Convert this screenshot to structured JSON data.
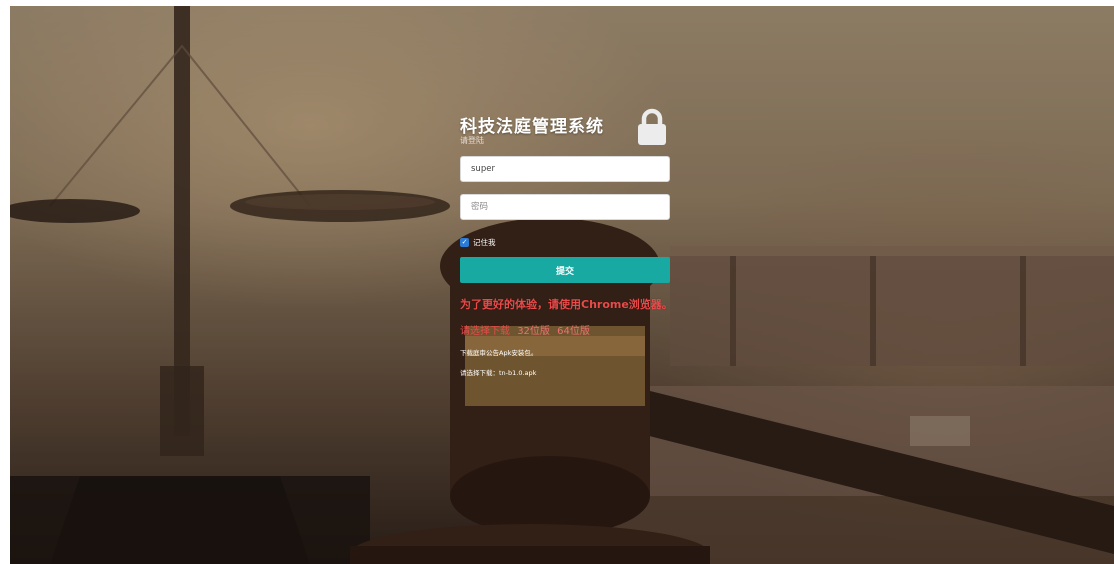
{
  "login": {
    "title": "科技法庭管理系统",
    "subtitle": "请登陆",
    "username_value": "super",
    "password_placeholder": "密码",
    "remember_label": "记住我",
    "remember_checked": true,
    "submit_label": "提交"
  },
  "notices": {
    "browser_notice": "为了更好的体验，请使用Chrome浏览器。",
    "download_prompt": "请选择下载",
    "version_32": "32位版",
    "version_64": "64位版",
    "apk_notice": "下载庭审公告Apk安装包。",
    "apk_download_prompt": "请选择下载：",
    "apk_file": "tn-b1.0.apk"
  },
  "colors": {
    "accent": "#18aaa2",
    "notice_red": "#e94a4a",
    "checkbox_blue": "#2b7bd6"
  },
  "icons": {
    "lock": "lock-icon",
    "checkbox": "checkbox-checked-icon"
  }
}
